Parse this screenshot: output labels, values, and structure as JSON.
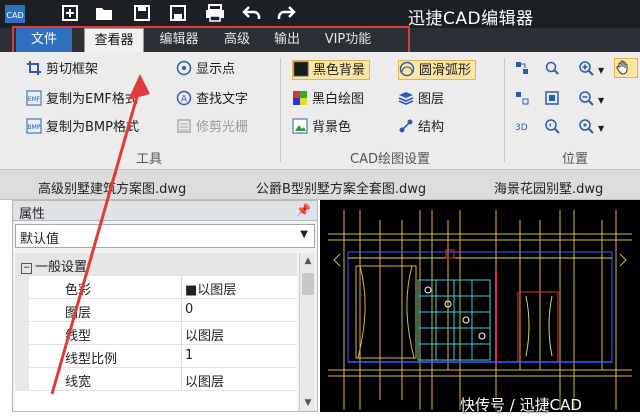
{
  "titlebar": {
    "quick_access_icons": [
      "cad-logo-icon",
      "new-file-icon",
      "open-folder-icon",
      "save-icon",
      "save-as-icon",
      "print-icon",
      "undo-icon",
      "redo-icon"
    ],
    "logo_text": "CAD",
    "app_title": "迅捷CAD编辑器"
  },
  "menu": {
    "tabs": [
      "文件",
      "查看器",
      "编辑器",
      "高级",
      "输出",
      "VIP功能"
    ],
    "active_tab": "查看器"
  },
  "ribbon": {
    "tools_group": {
      "label": "工具",
      "items": [
        "剪切框架",
        "复制为EMF格式",
        "复制为BMP格式"
      ],
      "items2": [
        "显示点",
        "查找文字",
        "修剪光栅"
      ]
    },
    "cad_group": {
      "label": "CAD绘图设置",
      "items": [
        "黑色背景",
        "黑白绘图",
        "背景色"
      ],
      "items2": [
        "圆滑弧形",
        "图层",
        "结构"
      ]
    },
    "position_group": {
      "label": "位置"
    }
  },
  "doc_tabs": [
    "高级别墅建筑方案图.dwg",
    "公爵B型别墅方案全套图.dwg",
    "海景花园别墅.dwg"
  ],
  "properties": {
    "title": "属性",
    "pin": "ᵖ",
    "selector": "默认值",
    "group": "一般设置",
    "rows": [
      {
        "name": "色彩",
        "value": "■以图层"
      },
      {
        "name": "图层",
        "value": "0"
      },
      {
        "name": "线型",
        "value": "以图层"
      },
      {
        "name": "线型比例",
        "value": "1"
      },
      {
        "name": "线宽",
        "value": "以图层"
      }
    ]
  },
  "watermark": "快传号 / 迅捷CAD",
  "colors": {
    "titlebar": "#1c1f24",
    "menubar": "#2b2f36",
    "file_tab": "#2f6fbf",
    "highlight": "#e23a3a",
    "canvas": "#000000"
  }
}
